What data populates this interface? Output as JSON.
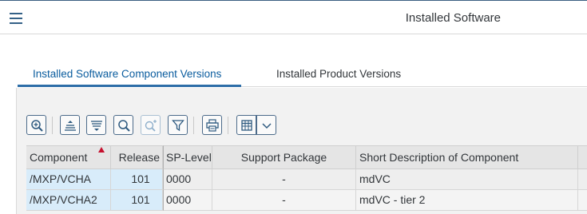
{
  "header": {
    "title": "Installed Software",
    "menu_icon": "hamburger-menu-icon"
  },
  "tabs": [
    {
      "label": "Installed Software Component Versions",
      "active": true
    },
    {
      "label": "Installed Product Versions",
      "active": false
    }
  ],
  "toolbar": {
    "buttons": [
      "zoom-details-icon",
      "sort-ascending-icon",
      "sort-descending-icon",
      "find-icon",
      "find-next-icon",
      "filter-icon",
      "print-icon",
      "layout-grid-icon",
      "chevron-down-icon"
    ]
  },
  "table": {
    "columns": [
      "Component",
      "Release",
      "SP-Level",
      "Support Package",
      "Short Description of Component"
    ],
    "sorted_column": "Component",
    "rows": [
      {
        "component": "/MXP/VCHA",
        "release": "101",
        "sp_level": "0000",
        "support_package": "-",
        "description": "mdVC"
      },
      {
        "component": "/MXP/VCHA2",
        "release": "101",
        "sp_level": "0000",
        "support_package": "-",
        "description": "mdVC - tier 2"
      }
    ]
  },
  "colors": {
    "accent": "#0a5c9e",
    "key_cell": "#d8ecfa",
    "sort_indicator": "#c6102e"
  }
}
